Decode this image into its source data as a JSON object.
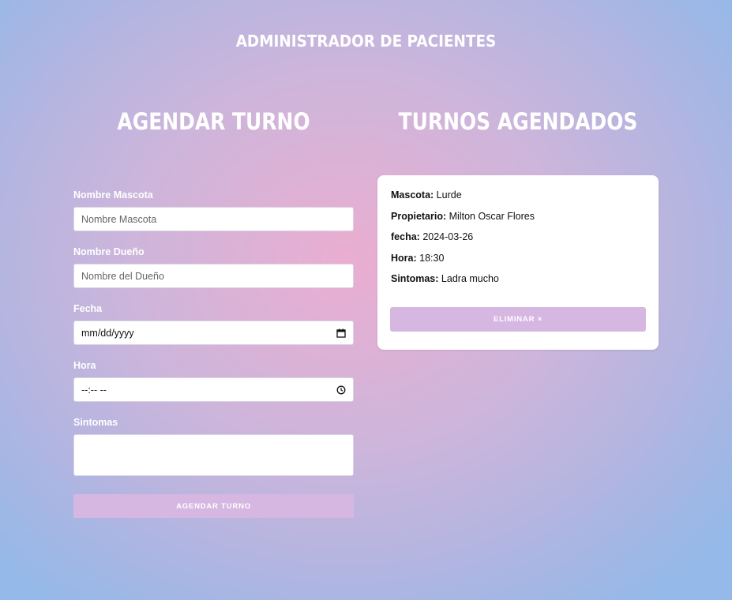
{
  "app": {
    "title": "ADMINISTRADOR DE PACIENTES"
  },
  "form": {
    "title": "AGENDAR TURNO",
    "fields": [
      {
        "label": "Nombre Mascota",
        "placeholder": "Nombre Mascota"
      },
      {
        "label": "Nombre Dueño",
        "placeholder": "Nombre del Dueño"
      },
      {
        "label": "Fecha",
        "value": "mm/dd/yyyy",
        "icon": "calendar-icon"
      },
      {
        "label": "Hora",
        "value": "--:-- --",
        "icon": "clock-icon"
      },
      {
        "label": "Sintomas",
        "value": ""
      }
    ],
    "submit_label": "AGENDAR TURNO"
  },
  "list": {
    "title": "TURNOS AGENDADOS",
    "appointments": [
      {
        "mascota_label": "Mascota:",
        "mascota": "Lurde",
        "propietario_label": "Propietario:",
        "propietario": "Milton Oscar Flores",
        "fecha_label": "fecha:",
        "fecha": "2024-03-26",
        "hora_label": "Hora:",
        "hora": "18:30",
        "sintomas_label": "Sintomas:",
        "sintomas": "Ladra mucho",
        "delete_label": "ELIMINAR ×"
      }
    ]
  },
  "colors": {
    "button": "#d6b7e2",
    "background_center": "#eaaed1",
    "background_edge": "#95b9e8"
  }
}
